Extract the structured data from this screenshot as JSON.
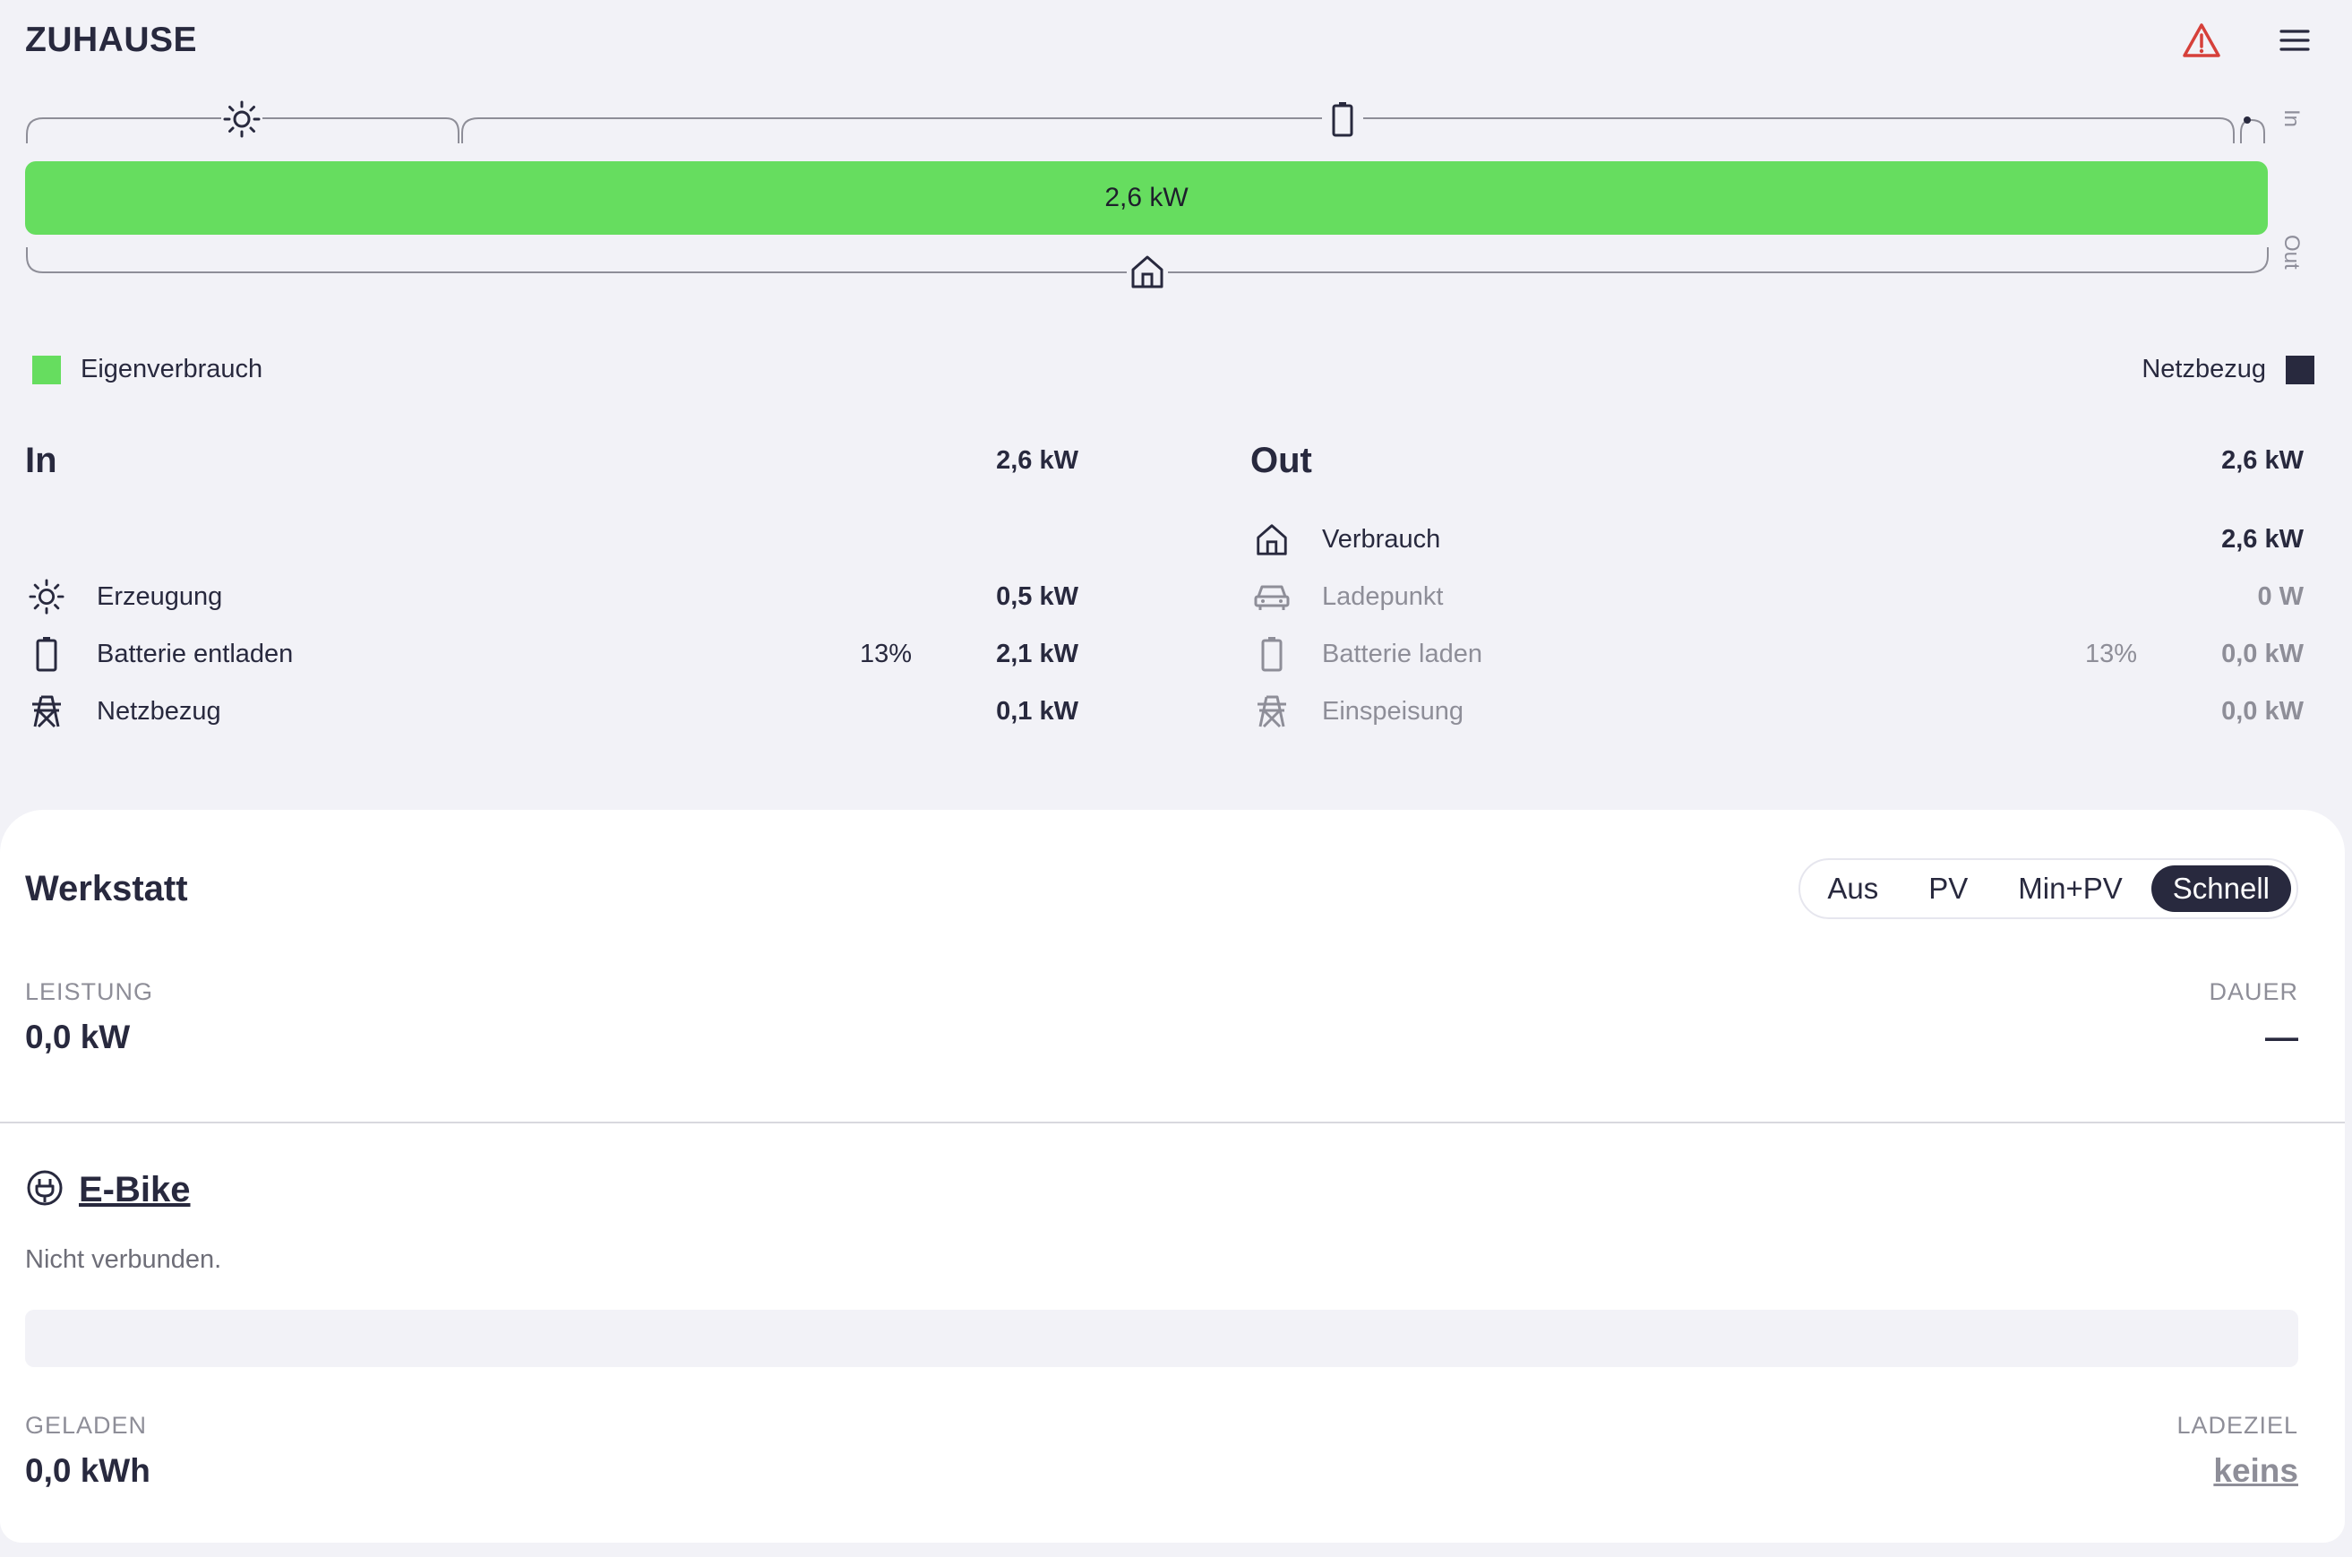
{
  "header": {
    "title": "ZUHAUSE",
    "warning_icon": "warning-triangle-icon",
    "menu_icon": "hamburger-menu-icon"
  },
  "flow": {
    "bar_label": "2,6 kW",
    "self_consumption_fraction": 1.0,
    "in_label": "In",
    "out_label": "Out"
  },
  "legend": {
    "left_label": "Eigenverbrauch",
    "left_color": "#66dd5f",
    "right_label": "Netzbezug",
    "right_color": "#28293e"
  },
  "in": {
    "title": "In",
    "total": "2,6 kW",
    "rows": [
      {
        "icon": "sun-icon",
        "label": "Erzeugung",
        "pct": "",
        "value": "0,5 kW"
      },
      {
        "icon": "battery-icon",
        "label": "Batterie entladen",
        "pct": "13%",
        "value": "2,1 kW"
      },
      {
        "icon": "grid-tower-icon",
        "label": "Netzbezug",
        "pct": "",
        "value": "0,1 kW"
      }
    ]
  },
  "out": {
    "title": "Out",
    "total": "2,6 kW",
    "rows": [
      {
        "icon": "house-icon",
        "label": "Verbrauch",
        "pct": "",
        "value": "2,6 kW"
      },
      {
        "icon": "car-icon",
        "label": "Ladepunkt",
        "pct": "",
        "value": "0 W"
      },
      {
        "icon": "battery-icon",
        "label": "Batterie laden",
        "pct": "13%",
        "value": "0,0 kW"
      },
      {
        "icon": "grid-tower-icon",
        "label": "Einspeisung",
        "pct": "",
        "value": "0,0 kW"
      }
    ]
  },
  "loadpoint": {
    "title": "Werkstatt",
    "modes": [
      "Aus",
      "PV",
      "Min+PV",
      "Schnell"
    ],
    "active_mode": "Schnell",
    "power_label": "LEISTUNG",
    "power_value": "0,0 kW",
    "duration_label": "DAUER",
    "duration_value": "—",
    "vehicle_name": "E-Bike",
    "vehicle_status": "Nicht verbunden.",
    "charged_label": "GELADEN",
    "charged_value": "0,0 kWh",
    "target_label": "LADEZIEL",
    "target_value": "keins"
  }
}
